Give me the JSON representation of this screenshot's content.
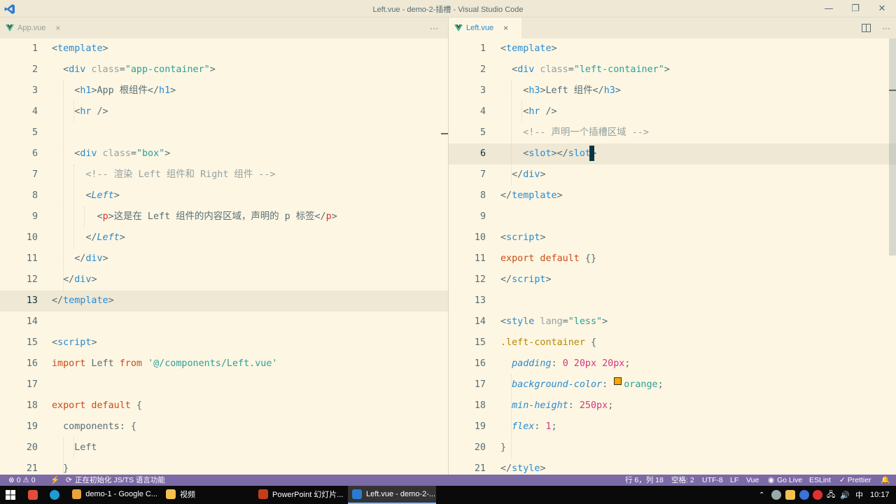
{
  "window": {
    "title": "Left.vue - demo-2-插槽 - Visual Studio Code"
  },
  "left_editor": {
    "tab": {
      "label": "App.vue",
      "close": "×"
    },
    "more": "···",
    "start_line": 1,
    "highlight_line": 13,
    "lines": [
      [
        [
          "<",
          "br"
        ],
        [
          "template",
          "tag"
        ],
        [
          ">",
          "br"
        ]
      ],
      [
        [
          "  <",
          "br"
        ],
        [
          "div",
          "tag"
        ],
        [
          " class",
          "attr"
        ],
        [
          "=",
          "br"
        ],
        [
          "\"app-container\"",
          "str"
        ],
        [
          ">",
          "br"
        ]
      ],
      [
        [
          "    <",
          "br"
        ],
        [
          "h1",
          "tag"
        ],
        [
          ">App 根组件</",
          "txt"
        ],
        [
          "h1",
          "tag"
        ],
        [
          ">",
          "br"
        ]
      ],
      [
        [
          "    <",
          "br"
        ],
        [
          "hr",
          "tag"
        ],
        [
          " />",
          "br"
        ]
      ],
      [],
      [
        [
          "    <",
          "br"
        ],
        [
          "div",
          "tag"
        ],
        [
          " class",
          "attr"
        ],
        [
          "=",
          "br"
        ],
        [
          "\"box\"",
          "str"
        ],
        [
          ">",
          "br"
        ]
      ],
      [
        [
          "      <!-- 渲染 Left 组件和 Right 组件 -->",
          "cmt"
        ]
      ],
      [
        [
          "      <",
          "br"
        ],
        [
          "Left",
          "ital"
        ],
        [
          ">",
          "br"
        ]
      ],
      [
        [
          "        <",
          "br"
        ],
        [
          "p",
          "tagred"
        ],
        [
          ">这是在 Left 组件的内容区域，声明的 p 标签</",
          "txt"
        ],
        [
          "p",
          "tagred"
        ],
        [
          ">",
          "br"
        ]
      ],
      [
        [
          "      </",
          "br"
        ],
        [
          "Left",
          "ital"
        ],
        [
          ">",
          "br"
        ]
      ],
      [
        [
          "    </",
          "br"
        ],
        [
          "div",
          "tag"
        ],
        [
          ">",
          "br"
        ]
      ],
      [
        [
          "  </",
          "br"
        ],
        [
          "div",
          "tag"
        ],
        [
          ">",
          "br"
        ]
      ],
      [
        [
          "</",
          "br"
        ],
        [
          "template",
          "tag"
        ],
        [
          ">",
          "br"
        ]
      ],
      [],
      [
        [
          "<",
          "br"
        ],
        [
          "script",
          "tag"
        ],
        [
          ">",
          "br"
        ]
      ],
      [
        [
          "import",
          "kw"
        ],
        [
          " Left ",
          "txt"
        ],
        [
          "from",
          "kw"
        ],
        [
          " ",
          "txt"
        ],
        [
          "'@/components/Left.vue'",
          "str"
        ]
      ],
      [],
      [
        [
          "export default",
          "kw"
        ],
        [
          " {",
          "txt"
        ]
      ],
      [
        [
          "  components: {",
          "txt"
        ]
      ],
      [
        [
          "    Left",
          "txt"
        ]
      ],
      [
        [
          "  }",
          "txt"
        ]
      ]
    ]
  },
  "right_editor": {
    "tab": {
      "label": "Left.vue",
      "close": "×"
    },
    "start_line": 1,
    "highlight_line": 6,
    "lines": [
      [
        [
          "<",
          "br"
        ],
        [
          "template",
          "tag"
        ],
        [
          ">",
          "br"
        ]
      ],
      [
        [
          "  <",
          "br"
        ],
        [
          "div",
          "tag"
        ],
        [
          " class",
          "attr"
        ],
        [
          "=",
          "br"
        ],
        [
          "\"left-container\"",
          "str"
        ],
        [
          ">",
          "br"
        ]
      ],
      [
        [
          "    <",
          "br"
        ],
        [
          "h3",
          "tag"
        ],
        [
          ">Left 组件</",
          "txt"
        ],
        [
          "h3",
          "tag"
        ],
        [
          ">",
          "br"
        ]
      ],
      [
        [
          "    <",
          "br"
        ],
        [
          "hr",
          "tag"
        ],
        [
          " />",
          "br"
        ]
      ],
      [
        [
          "    <!-- 声明一个插槽区域 -->",
          "cmt"
        ]
      ],
      [
        [
          "    <",
          "br"
        ],
        [
          "slot",
          "tag"
        ],
        [
          "></",
          "br"
        ],
        [
          "slot",
          "tag"
        ],
        [
          ">",
          "br"
        ]
      ],
      [
        [
          "  </",
          "br"
        ],
        [
          "div",
          "tag"
        ],
        [
          ">",
          "br"
        ]
      ],
      [
        [
          "</",
          "br"
        ],
        [
          "template",
          "tag"
        ],
        [
          ">",
          "br"
        ]
      ],
      [],
      [
        [
          "<",
          "br"
        ],
        [
          "script",
          "tag"
        ],
        [
          ">",
          "br"
        ]
      ],
      [
        [
          "export default",
          "kw"
        ],
        [
          " {}",
          "txt"
        ]
      ],
      [
        [
          "</",
          "br"
        ],
        [
          "script",
          "tag"
        ],
        [
          ">",
          "br"
        ]
      ],
      [],
      [
        [
          "<",
          "br"
        ],
        [
          "style",
          "tag"
        ],
        [
          " lang",
          "attr"
        ],
        [
          "=",
          "br"
        ],
        [
          "\"less\"",
          "str"
        ],
        [
          ">",
          "br"
        ]
      ],
      [
        [
          ".left-container",
          "cls"
        ],
        [
          " {",
          "txt"
        ]
      ],
      [
        [
          "  padding",
          "prop"
        ],
        [
          ": ",
          "txt"
        ],
        [
          "0 20px 20px",
          "num"
        ],
        [
          ";",
          "txt"
        ]
      ],
      [
        [
          "  background-color",
          "prop"
        ],
        [
          ": ",
          "txt"
        ],
        [
          "■",
          "swatch"
        ],
        [
          "orange",
          "str"
        ],
        [
          ";",
          "txt"
        ]
      ],
      [
        [
          "  min-height",
          "prop"
        ],
        [
          ": ",
          "txt"
        ],
        [
          "250px",
          "num"
        ],
        [
          ";",
          "txt"
        ]
      ],
      [
        [
          "  flex",
          "prop"
        ],
        [
          ": ",
          "txt"
        ],
        [
          "1",
          "num"
        ],
        [
          ";",
          "txt"
        ]
      ],
      [
        [
          "}",
          "txt"
        ]
      ],
      [
        [
          "</",
          "br"
        ],
        [
          "style",
          "tag"
        ],
        [
          ">",
          "br"
        ]
      ]
    ]
  },
  "status_bar": {
    "problems": "⊗ 0 ⚠ 0",
    "bolt": "⚡",
    "initializing": "正在初始化 JS/TS 语言功能",
    "position": "行 6，列 18",
    "spaces": "空格: 2",
    "encoding": "UTF-8",
    "eol": "LF",
    "language": "Vue",
    "golive": "Go Live",
    "eslint": "ESLint",
    "prettier": "✓ Prettier"
  },
  "taskbar": {
    "apps": [
      {
        "label": "demo-1 - Google C...",
        "color": "#e8a33d",
        "active": false
      },
      {
        "label": "视频",
        "color": "#f2c14e",
        "active": false
      },
      {
        "label": "PowerPoint 幻灯片...",
        "color": "#c43e1c",
        "active": false
      },
      {
        "label": "Left.vue - demo-2-...",
        "color": "#2b7bd1",
        "active": true
      }
    ],
    "ime": "中",
    "time": "10:17"
  },
  "colors": {
    "statusbar": "#7c6aa6",
    "editor_bg": "#fdf6e3",
    "swatch": "#ffa500"
  }
}
